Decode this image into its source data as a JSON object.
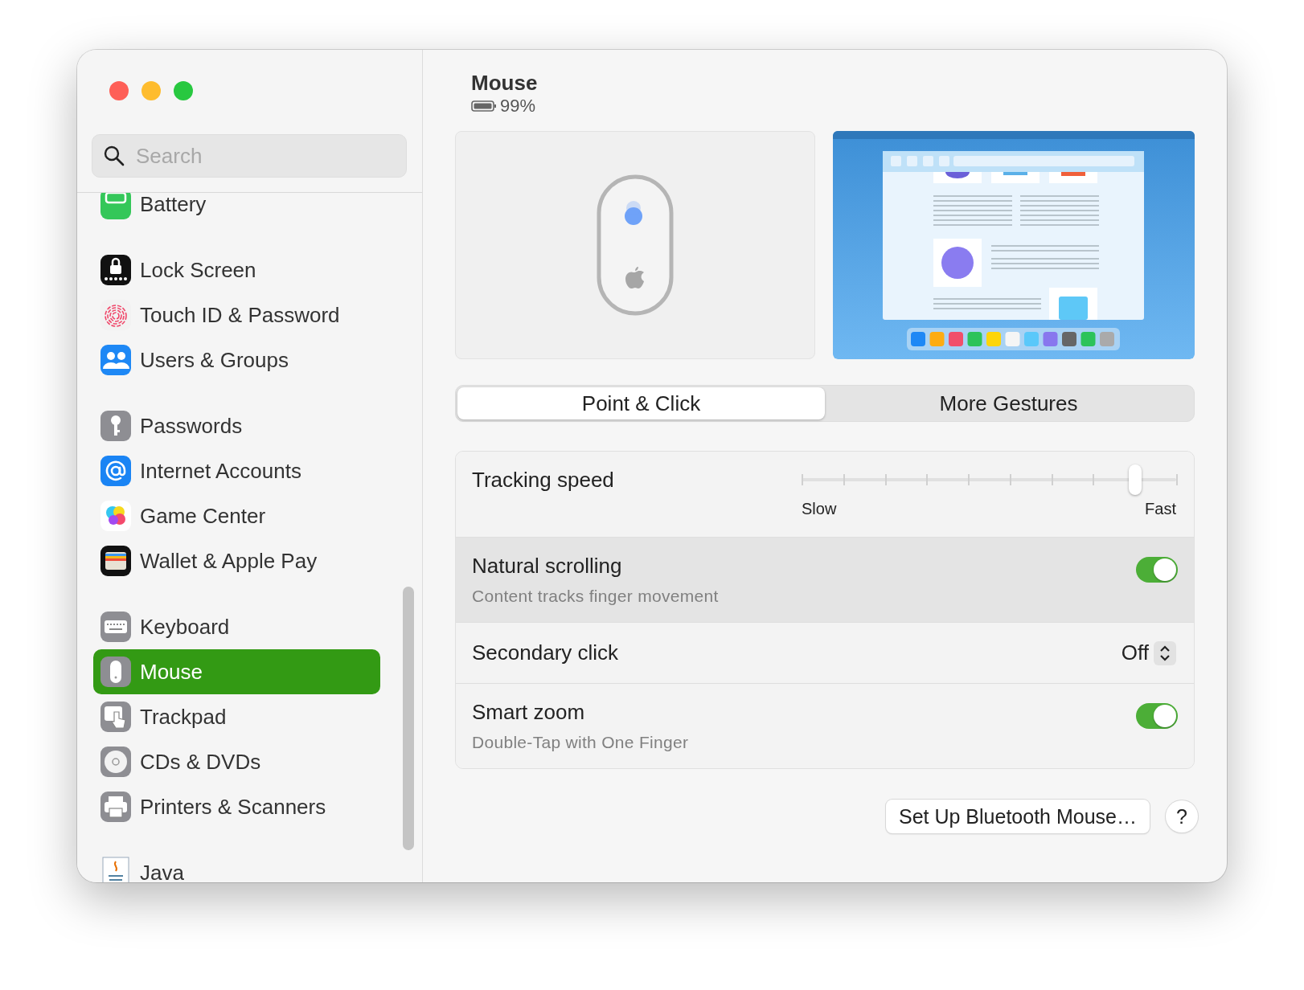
{
  "window": {
    "title": "Mouse",
    "battery": "99%"
  },
  "sidebar": {
    "search": {
      "placeholder": "Search"
    },
    "groups": [
      {
        "items": [
          {
            "label": "Battery",
            "selected": false
          }
        ]
      },
      {
        "items": [
          {
            "label": "Lock Screen",
            "selected": false
          },
          {
            "label": "Touch ID & Password",
            "selected": false
          },
          {
            "label": "Users & Groups",
            "selected": false
          }
        ]
      },
      {
        "items": [
          {
            "label": "Passwords",
            "selected": false
          },
          {
            "label": "Internet Accounts",
            "selected": false
          },
          {
            "label": "Game Center",
            "selected": false
          },
          {
            "label": "Wallet & Apple Pay",
            "selected": false
          }
        ]
      },
      {
        "items": [
          {
            "label": "Keyboard",
            "selected": false
          },
          {
            "label": "Mouse",
            "selected": true
          },
          {
            "label": "Trackpad",
            "selected": false
          },
          {
            "label": "CDs & DVDs",
            "selected": false
          },
          {
            "label": "Printers & Scanners",
            "selected": false
          }
        ]
      },
      {
        "items": [
          {
            "label": "Java",
            "selected": false
          }
        ]
      }
    ]
  },
  "tabs": [
    {
      "label": "Point & Click",
      "selected": true
    },
    {
      "label": "More Gestures",
      "selected": false
    }
  ],
  "settings": [
    {
      "kind": "slider",
      "label": "Tracking speed",
      "level": 0.89,
      "min_label": "Slow",
      "max_label": "Fast",
      "highlighted": false
    },
    {
      "kind": "toggle",
      "label": "Natural scrolling",
      "detail": "Content tracks finger movement",
      "on": true,
      "highlighted": true
    },
    {
      "kind": "popup",
      "label": "Secondary click",
      "value": "Off",
      "highlighted": false
    },
    {
      "kind": "toggle",
      "label": "Smart zoom",
      "detail": "Double-Tap with One Finger",
      "on": true,
      "highlighted": false
    }
  ],
  "buttons": [
    {
      "kind": "text",
      "label": "Set Up Bluetooth Mouse…"
    },
    {
      "kind": "help",
      "label": "?"
    }
  ]
}
